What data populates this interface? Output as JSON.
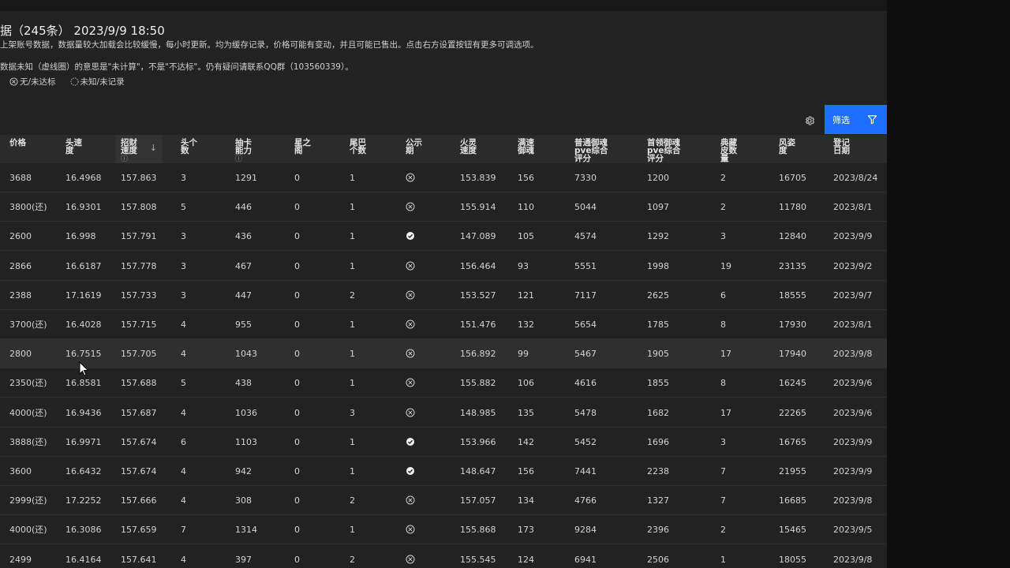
{
  "header": {
    "title": "据（245条）  2023/9/9 18:50",
    "desc1": "上架账号数据，数据量较大加载会比较缓慢，每小时更新。均为缓存记录，价格可能有变动，并且可能已售出。点击右方设置按钮有更多可调选项。",
    "desc2": "数据未知（虚线圈）的意思是\"未计算\"，不是\"不达标\"。仍有疑问请联系QQ群（103560339）。"
  },
  "legend": {
    "no": "无/未达标",
    "unknown": "未知/未记录"
  },
  "toolbar": {
    "filter_label": "筛选",
    "settings_icon": "gear-icon",
    "filter_icon": "funnel-icon",
    "accent": "#1e6fff"
  },
  "columns": [
    {
      "key": "price",
      "label": "价格"
    },
    {
      "key": "head_speed",
      "label": "头速度"
    },
    {
      "key": "recruit_speed",
      "label": "招财速度",
      "sorted": "desc",
      "info": true
    },
    {
      "key": "head_count",
      "label": "头个数"
    },
    {
      "key": "draw",
      "label": "抽卡能力",
      "info": true
    },
    {
      "key": "xing",
      "label": "星之阁"
    },
    {
      "key": "tail",
      "label": "尾巴个数"
    },
    {
      "key": "public",
      "label": "公示期"
    },
    {
      "key": "fire",
      "label": "火灵速度"
    },
    {
      "key": "full",
      "label": "满速御魂"
    },
    {
      "key": "pve",
      "label": "普通御魂pve综合评分"
    },
    {
      "key": "pve_lead",
      "label": "首领御魂pve综合评分"
    },
    {
      "key": "skin",
      "label": "典藏皮数量"
    },
    {
      "key": "style",
      "label": "风姿度"
    },
    {
      "key": "date",
      "label": "登记日期"
    }
  ],
  "rows": [
    {
      "price": "3688",
      "head_speed": "16.4968",
      "recruit_speed": "157.863",
      "head_count": "3",
      "draw": "1291",
      "xing": "0",
      "tail": "1",
      "public": "no",
      "fire": "153.839",
      "full": "156",
      "pve": "7330",
      "pve_lead": "1200",
      "skin": "2",
      "style": "16705",
      "date": "2023/8/24"
    },
    {
      "price": "3800(还)",
      "head_speed": "16.9301",
      "recruit_speed": "157.808",
      "head_count": "5",
      "draw": "446",
      "xing": "0",
      "tail": "1",
      "public": "no",
      "fire": "155.914",
      "full": "110",
      "pve": "5044",
      "pve_lead": "1097",
      "skin": "2",
      "style": "11780",
      "date": "2023/8/1"
    },
    {
      "price": "2600",
      "head_speed": "16.998",
      "recruit_speed": "157.791",
      "head_count": "3",
      "draw": "436",
      "xing": "0",
      "tail": "1",
      "public": "yes",
      "fire": "147.089",
      "full": "105",
      "pve": "4574",
      "pve_lead": "1292",
      "skin": "3",
      "style": "12840",
      "date": "2023/9/9"
    },
    {
      "price": "2866",
      "head_speed": "16.6187",
      "recruit_speed": "157.778",
      "head_count": "3",
      "draw": "467",
      "xing": "0",
      "tail": "1",
      "public": "no",
      "fire": "156.464",
      "full": "93",
      "pve": "5551",
      "pve_lead": "1998",
      "skin": "19",
      "style": "23135",
      "date": "2023/9/2"
    },
    {
      "price": "2388",
      "head_speed": "17.1619",
      "recruit_speed": "157.733",
      "head_count": "3",
      "draw": "447",
      "xing": "0",
      "tail": "2",
      "public": "no",
      "fire": "153.527",
      "full": "121",
      "pve": "7117",
      "pve_lead": "2625",
      "skin": "6",
      "style": "18555",
      "date": "2023/9/7"
    },
    {
      "price": "3700(还)",
      "head_speed": "16.4028",
      "recruit_speed": "157.715",
      "head_count": "4",
      "draw": "955",
      "xing": "0",
      "tail": "1",
      "public": "no",
      "fire": "151.476",
      "full": "132",
      "pve": "5654",
      "pve_lead": "1785",
      "skin": "8",
      "style": "17930",
      "date": "2023/8/1"
    },
    {
      "price": "2800",
      "head_speed": "16.7515",
      "recruit_speed": "157.705",
      "head_count": "4",
      "draw": "1043",
      "xing": "0",
      "tail": "1",
      "public": "no",
      "fire": "156.892",
      "full": "99",
      "pve": "5467",
      "pve_lead": "1905",
      "skin": "17",
      "style": "17940",
      "date": "2023/9/8"
    },
    {
      "price": "2350(还)",
      "head_speed": "16.8581",
      "recruit_speed": "157.688",
      "head_count": "5",
      "draw": "438",
      "xing": "0",
      "tail": "1",
      "public": "no",
      "fire": "155.882",
      "full": "106",
      "pve": "4616",
      "pve_lead": "1855",
      "skin": "8",
      "style": "16245",
      "date": "2023/9/6"
    },
    {
      "price": "4000(还)",
      "head_speed": "16.9436",
      "recruit_speed": "157.687",
      "head_count": "4",
      "draw": "1036",
      "xing": "0",
      "tail": "3",
      "public": "no",
      "fire": "148.985",
      "full": "135",
      "pve": "5478",
      "pve_lead": "1682",
      "skin": "17",
      "style": "22265",
      "date": "2023/9/6"
    },
    {
      "price": "3888(还)",
      "head_speed": "16.9971",
      "recruit_speed": "157.674",
      "head_count": "6",
      "draw": "1103",
      "xing": "0",
      "tail": "1",
      "public": "yes",
      "fire": "153.966",
      "full": "142",
      "pve": "5452",
      "pve_lead": "1696",
      "skin": "3",
      "style": "16765",
      "date": "2023/9/9"
    },
    {
      "price": "3600",
      "head_speed": "16.6432",
      "recruit_speed": "157.674",
      "head_count": "4",
      "draw": "942",
      "xing": "0",
      "tail": "1",
      "public": "yes",
      "fire": "148.647",
      "full": "156",
      "pve": "7441",
      "pve_lead": "2238",
      "skin": "7",
      "style": "21955",
      "date": "2023/9/9"
    },
    {
      "price": "2999(还)",
      "head_speed": "17.2252",
      "recruit_speed": "157.666",
      "head_count": "4",
      "draw": "308",
      "xing": "0",
      "tail": "2",
      "public": "no",
      "fire": "157.057",
      "full": "134",
      "pve": "4766",
      "pve_lead": "1327",
      "skin": "7",
      "style": "16685",
      "date": "2023/9/8"
    },
    {
      "price": "4000(还)",
      "head_speed": "16.3086",
      "recruit_speed": "157.659",
      "head_count": "7",
      "draw": "1314",
      "xing": "0",
      "tail": "1",
      "public": "no",
      "fire": "155.868",
      "full": "173",
      "pve": "9284",
      "pve_lead": "2396",
      "skin": "2",
      "style": "15465",
      "date": "2023/9/5"
    },
    {
      "price": "2499",
      "head_speed": "16.4164",
      "recruit_speed": "157.641",
      "head_count": "4",
      "draw": "397",
      "xing": "0",
      "tail": "2",
      "public": "no",
      "fire": "155.545",
      "full": "124",
      "pve": "6941",
      "pve_lead": "2506",
      "skin": "1",
      "style": "18055",
      "date": "2023/9/8"
    }
  ]
}
